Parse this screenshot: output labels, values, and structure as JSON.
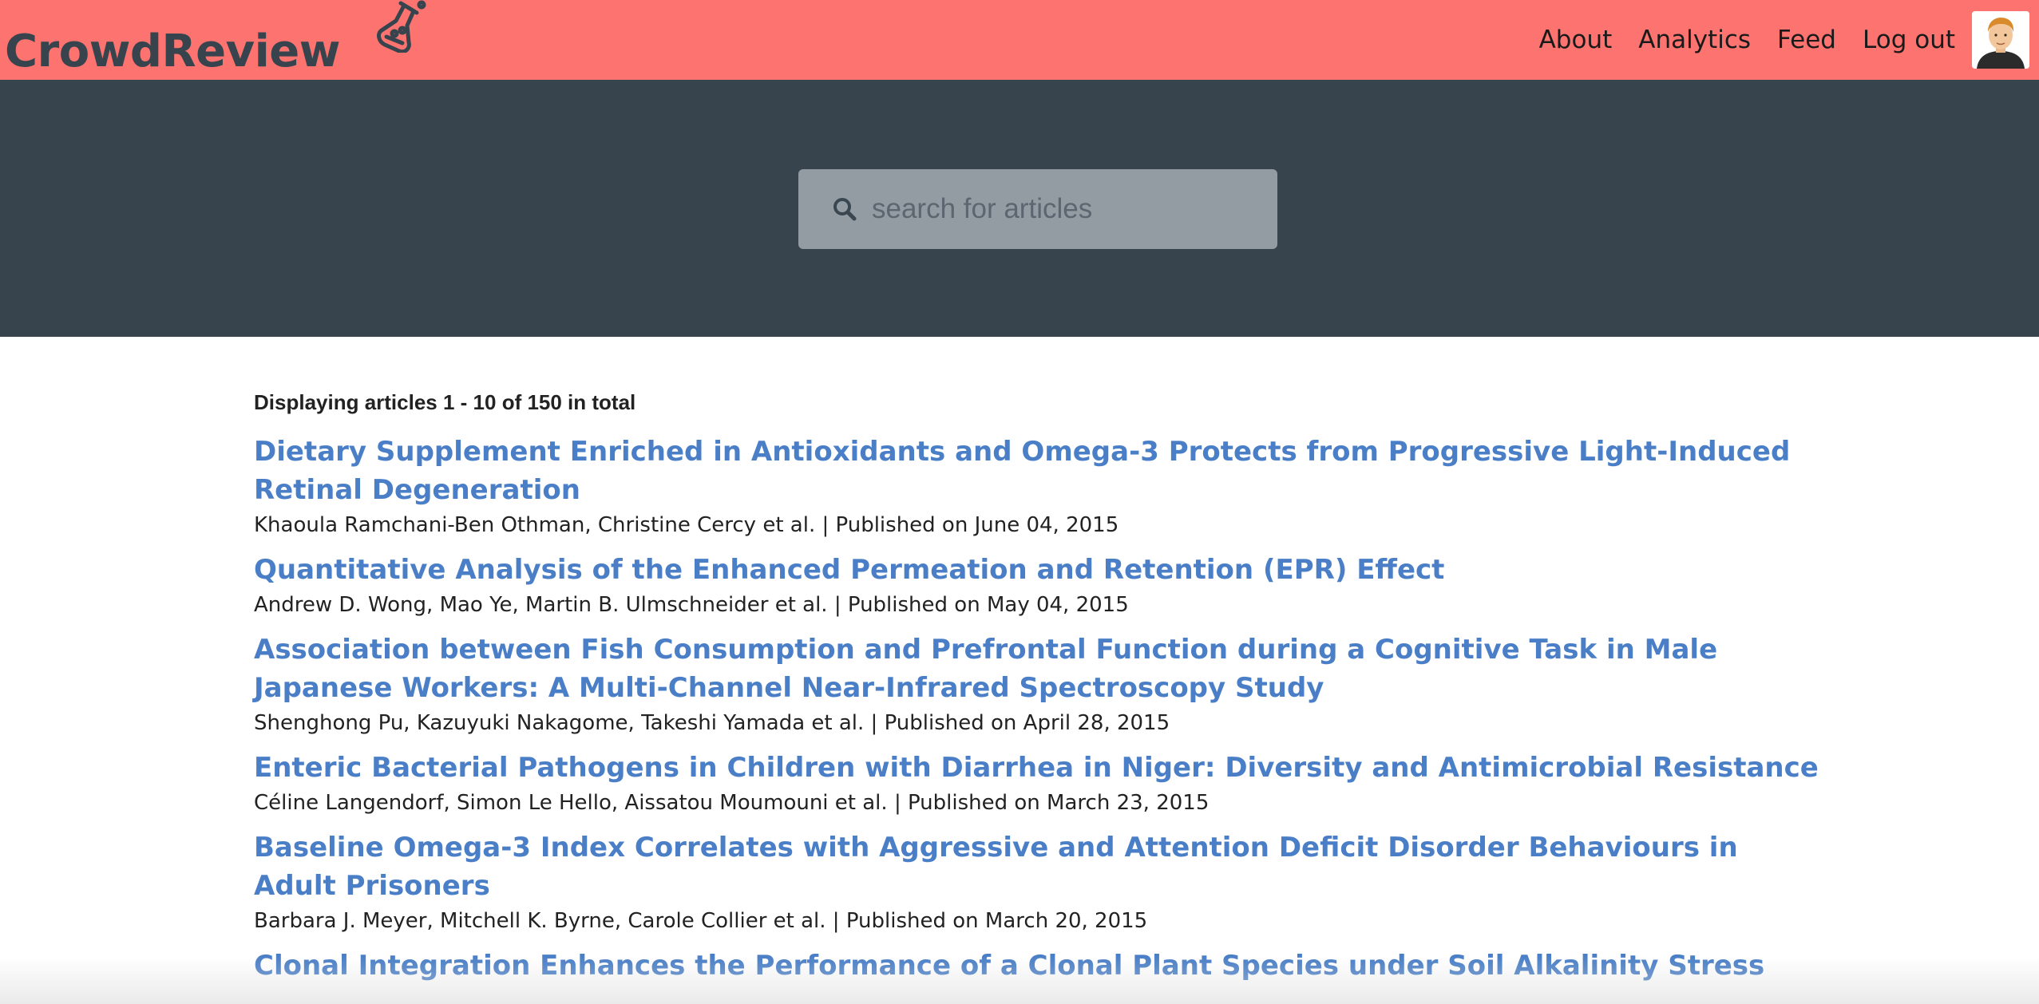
{
  "header": {
    "brand": "CrowdReview",
    "brand_icon": "flask-icon",
    "colors": {
      "bar": "#fc736f",
      "text": "#37444d"
    },
    "nav": [
      {
        "label": "About"
      },
      {
        "label": "Analytics"
      },
      {
        "label": "Feed"
      },
      {
        "label": "Log out"
      }
    ],
    "avatar_icon": "user-avatar-icon"
  },
  "search": {
    "placeholder": "search for articles",
    "value": "",
    "icon": "search-icon",
    "band_color": "#37444d"
  },
  "results": {
    "summary": "Displaying articles 1 - 10 of 150 in total",
    "link_color": "#4a7fc7",
    "articles": [
      {
        "title": "Dietary Supplement Enriched in Antioxidants and Omega-3 Protects from Progressive Light-Induced Retinal Degeneration",
        "meta": "Khaoula Ramchani-Ben Othman, Christine Cercy et al. | Published on June 04, 2015"
      },
      {
        "title": "Quantitative Analysis of the Enhanced Permeation and Retention (EPR) Effect",
        "meta": "Andrew D. Wong, Mao Ye, Martin B. Ulmschneider et al. | Published on May 04, 2015"
      },
      {
        "title": "Association between Fish Consumption and Prefrontal Function during a Cognitive Task in Male Japanese Workers: A Multi-Channel Near-Infrared Spectroscopy Study",
        "meta": "Shenghong Pu, Kazuyuki Nakagome, Takeshi Yamada et al. | Published on April 28, 2015"
      },
      {
        "title": "Enteric Bacterial Pathogens in Children with Diarrhea in Niger: Diversity and Antimicrobial Resistance",
        "meta": "Céline Langendorf, Simon Le Hello, Aissatou Moumouni et al. | Published on March 23, 2015"
      },
      {
        "title": "Baseline Omega-3 Index Correlates with Aggressive and Attention Deficit Disorder Behaviours in Adult Prisoners",
        "meta": "Barbara J. Meyer, Mitchell K. Byrne, Carole Collier et al. | Published on March 20, 2015"
      },
      {
        "title": "Clonal Integration Enhances the Performance of a Clonal Plant Species under Soil Alkalinity Stress",
        "meta": ""
      }
    ]
  }
}
